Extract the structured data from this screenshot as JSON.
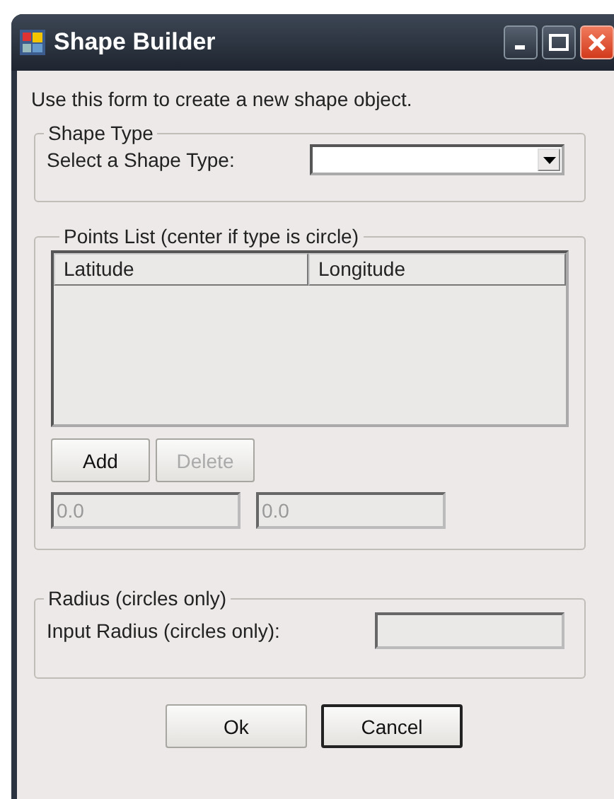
{
  "window": {
    "title": "Shape Builder"
  },
  "intro": "Use this form to create a new shape object.",
  "shape_type_group": {
    "title": "Shape Type",
    "label": "Select a Shape Type:"
  },
  "points_group": {
    "title": "Points List (center if type is circle)",
    "columns": [
      "Latitude",
      "Longitude"
    ],
    "buttons": [
      {
        "label": "Add",
        "disabled": false
      },
      {
        "label": "Delete",
        "disabled": true
      }
    ],
    "fields": [
      {
        "value": "0.0",
        "disabled": true
      },
      {
        "value": "0.0",
        "disabled": true
      }
    ]
  },
  "radius_group": {
    "title": "Radius (circles only)",
    "label": "Input Radius (circles only):",
    "field": {
      "disabled": true
    }
  },
  "buttons": [
    {
      "label": "Ok",
      "default": false
    },
    {
      "label": "Cancel",
      "default": true
    }
  ]
}
